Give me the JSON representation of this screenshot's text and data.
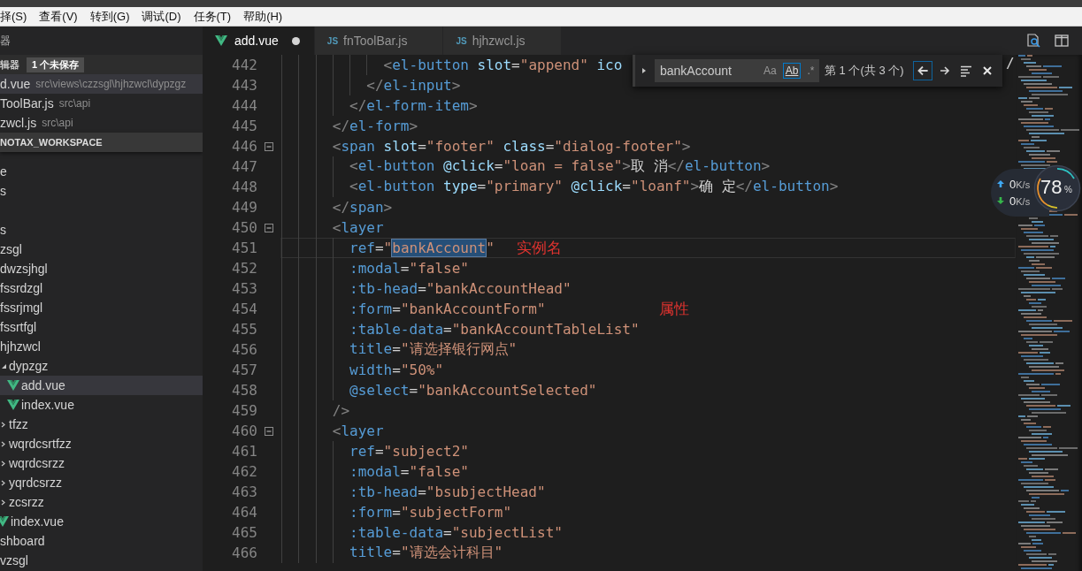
{
  "menu_bar": [
    "择(S)",
    "查看(V)",
    "转到(G)",
    "调试(D)",
    "任务(T)",
    "帮助(H)"
  ],
  "sidebar": {
    "title": "器",
    "open_editors": {
      "label": "辑器",
      "badge": "1 个未保存",
      "items": [
        {
          "name": "d.vue",
          "path": "src\\views\\czzsgl\\hjhzwcl\\dypzgz",
          "selected": true
        },
        {
          "name": "ToolBar.js",
          "path": "src\\api",
          "selected": false
        },
        {
          "name": "zwcl.js",
          "path": "src\\api",
          "selected": false
        }
      ]
    },
    "workspace": {
      "label": "NOTAX_WORKSPACE",
      "tree": [
        {
          "kind": "folder",
          "label": "e"
        },
        {
          "kind": "folder",
          "label": "s"
        },
        {
          "kind": "blank"
        },
        {
          "kind": "folder",
          "label": "s"
        },
        {
          "kind": "folder",
          "label": "zsgl"
        },
        {
          "kind": "folder",
          "label": "dwzsjhgl"
        },
        {
          "kind": "folder",
          "label": "fssrdzgl"
        },
        {
          "kind": "folder",
          "label": "fssrjmgl"
        },
        {
          "kind": "folder",
          "label": "fssrtfgl"
        },
        {
          "kind": "folder",
          "label": "hjhzwcl",
          "children": [
            {
              "kind": "folder",
              "label": "dypzgz",
              "expanded": true,
              "children": [
                {
                  "kind": "vue",
                  "label": "add.vue",
                  "selected": true
                },
                {
                  "kind": "vue",
                  "label": "index.vue",
                  "selected": false
                }
              ]
            },
            {
              "kind": "folder",
              "label": "tfzz",
              "expanded": false
            },
            {
              "kind": "folder",
              "label": "wqrdcsrtfzz",
              "expanded": false
            },
            {
              "kind": "folder",
              "label": "wqrdcsrzz",
              "expanded": false
            },
            {
              "kind": "folder",
              "label": "yqrdcsrzz",
              "expanded": false
            },
            {
              "kind": "folder",
              "label": "zcsrzz",
              "expanded": false
            },
            {
              "kind": "vue",
              "label": "index.vue",
              "selected": false
            }
          ]
        },
        {
          "kind": "folder",
          "label": "shboard"
        },
        {
          "kind": "folder",
          "label": "vzsgl"
        }
      ]
    }
  },
  "tabs": [
    {
      "kind": "vue",
      "label": "add.vue",
      "selected": true,
      "dirty": true
    },
    {
      "kind": "js",
      "icon_text": "JS",
      "label": "fnToolBar.js",
      "selected": false,
      "dirty": false
    },
    {
      "kind": "js",
      "icon_text": "JS",
      "label": "hjhzwcl.js",
      "selected": false,
      "dirty": false
    }
  ],
  "editor": {
    "lines": [
      {
        "number": "442",
        "foldable": false,
        "current": false,
        "segments": [
          {
            "text": "            <el-button slot=\"append\" ico",
            "match": false
          }
        ]
      },
      {
        "number": "443",
        "foldable": false,
        "current": false,
        "segments": [
          {
            "text": "          </el-input>",
            "match": false
          }
        ]
      },
      {
        "number": "444",
        "foldable": false,
        "current": false,
        "segments": [
          {
            "text": "        </el-form-item>",
            "match": false
          }
        ]
      },
      {
        "number": "445",
        "foldable": false,
        "current": false,
        "segments": [
          {
            "text": "      </el-form>",
            "match": false
          }
        ]
      },
      {
        "number": "446",
        "foldable": true,
        "current": false,
        "segments": [
          {
            "text": "      <span slot=\"footer\" class=\"dialog-footer\">",
            "match": false
          }
        ]
      },
      {
        "number": "447",
        "foldable": false,
        "current": false,
        "segments": [
          {
            "text": "        <el-button @click=\"loan = false\">取 消</el-button>",
            "match": false
          }
        ]
      },
      {
        "number": "448",
        "foldable": false,
        "current": false,
        "segments": [
          {
            "text": "        <el-button type=\"primary\" @click=\"loanf\">确 定</el-button>",
            "match": false
          }
        ]
      },
      {
        "number": "449",
        "foldable": false,
        "current": false,
        "segments": [
          {
            "text": "      </span>",
            "match": false
          }
        ]
      },
      {
        "number": "450",
        "foldable": true,
        "current": false,
        "segments": [
          {
            "text": "      <layer",
            "match": false
          }
        ]
      },
      {
        "number": "451",
        "foldable": false,
        "current": true,
        "segments": [
          {
            "text": "        ref=\"",
            "match": false
          },
          {
            "text": "bankAccount",
            "match": true
          },
          {
            "text": "\"",
            "match": false
          }
        ]
      },
      {
        "number": "452",
        "foldable": false,
        "current": false,
        "segments": [
          {
            "text": "        :modal=\"false\"",
            "match": false
          }
        ]
      },
      {
        "number": "453",
        "foldable": false,
        "current": false,
        "segments": [
          {
            "text": "        :tb-head=\"bankAccountHead\"",
            "match": false
          }
        ]
      },
      {
        "number": "454",
        "foldable": false,
        "current": false,
        "segments": [
          {
            "text": "        :form=\"bankAccountForm\"",
            "match": false
          }
        ]
      },
      {
        "number": "455",
        "foldable": false,
        "current": false,
        "segments": [
          {
            "text": "        :table-data=\"bankAccountTableList\"",
            "match": false
          }
        ]
      },
      {
        "number": "456",
        "foldable": false,
        "current": false,
        "segments": [
          {
            "text": "        title=\"请选择银行网点\"",
            "match": false
          }
        ]
      },
      {
        "number": "457",
        "foldable": false,
        "current": false,
        "segments": [
          {
            "text": "        width=\"50%\"",
            "match": false
          }
        ]
      },
      {
        "number": "458",
        "foldable": false,
        "current": false,
        "segments": [
          {
            "text": "        @select=\"bankAccountSelected\"",
            "match": false
          }
        ]
      },
      {
        "number": "459",
        "foldable": false,
        "current": false,
        "segments": [
          {
            "text": "      />",
            "match": false
          }
        ]
      },
      {
        "number": "460",
        "foldable": true,
        "current": false,
        "segments": [
          {
            "text": "      <layer",
            "match": false
          }
        ]
      },
      {
        "number": "461",
        "foldable": false,
        "current": false,
        "segments": [
          {
            "text": "        ref=\"subject2\"",
            "match": false
          }
        ]
      },
      {
        "number": "462",
        "foldable": false,
        "current": false,
        "segments": [
          {
            "text": "        :modal=\"false\"",
            "match": false
          }
        ]
      },
      {
        "number": "463",
        "foldable": false,
        "current": false,
        "segments": [
          {
            "text": "        :tb-head=\"bsubjectHead\"",
            "match": false
          }
        ]
      },
      {
        "number": "464",
        "foldable": false,
        "current": false,
        "segments": [
          {
            "text": "        :form=\"subjectForm\"",
            "match": false
          }
        ]
      },
      {
        "number": "465",
        "foldable": false,
        "current": false,
        "segments": [
          {
            "text": "        :table-data=\"subjectList\"",
            "match": false
          }
        ]
      },
      {
        "number": "466",
        "foldable": false,
        "current": false,
        "segments": [
          {
            "text": "        title=\"请选会计科目\"",
            "match": false
          }
        ]
      }
    ],
    "annotations": [
      {
        "kind": "note",
        "text": "实例名"
      },
      {
        "kind": "note",
        "text": "属性"
      },
      {
        "kind": "code",
        "text": "/"
      }
    ]
  },
  "find": {
    "value": "bankAccount",
    "options": [
      {
        "kind": "case",
        "label": "Aa",
        "selected": false
      },
      {
        "kind": "word",
        "label": "Ab",
        "selected": true
      },
      {
        "kind": "regex",
        "label": ".*",
        "selected": false
      }
    ],
    "result": "第 1 个(共 3 个)"
  },
  "net_monitor": {
    "upload": {
      "value": "0",
      "unit": "K/s"
    },
    "download": {
      "value": "0",
      "unit": "K/s"
    },
    "gauge": {
      "value": "78",
      "unit": "%"
    }
  }
}
